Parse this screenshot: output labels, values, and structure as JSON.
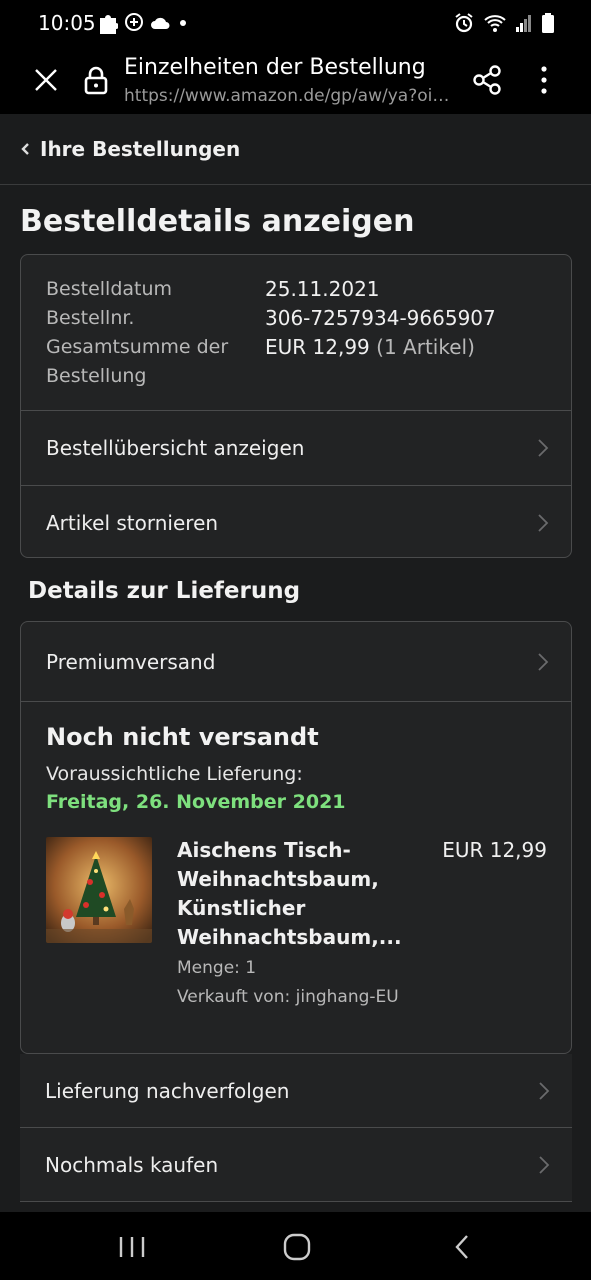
{
  "status_bar": {
    "time": "10:05"
  },
  "browser": {
    "title": "Einzelheiten der Bestellung",
    "url": "https://www.amazon.de/gp/aw/ya?oi…"
  },
  "breadcrumb": {
    "label": "Ihre Bestellungen"
  },
  "page_heading": "Bestelldetails anzeigen",
  "summary": {
    "order_date_label": "Bestelldatum",
    "order_date": "25.11.2021",
    "order_number_label": "Bestellnr.",
    "order_number": "306-7257934-9665907",
    "total_label_line1": "Gesamtsumme der",
    "total_label_line2": "Bestellung",
    "total_value": "EUR 12,99",
    "total_items": "(1 Artikel)",
    "rows": [
      {
        "label": "Bestellübersicht anzeigen"
      },
      {
        "label": "Artikel stornieren"
      }
    ]
  },
  "delivery": {
    "heading": "Details zur Lieferung",
    "shipping_method": "Premiumversand",
    "status": "Noch nicht versandt",
    "expected_label": "Voraussichtliche Lieferung:",
    "expected_date": "Freitag, 26. November 2021",
    "product": {
      "title": "Aischens Tisch-Weihnachtsbaum, Künstlicher Weihnachtsbaum,...",
      "price": "EUR 12,99",
      "quantity": "Menge: 1",
      "seller": "Verkauft von: jinghang-EU"
    }
  },
  "actions": [
    {
      "label": "Lieferung nachverfolgen"
    },
    {
      "label": "Nochmals kaufen"
    }
  ],
  "colors": {
    "background": "#1b1c1d",
    "card": "#222324",
    "delivery_date_green": "#7ee07e",
    "border": "#4a4b4c"
  }
}
